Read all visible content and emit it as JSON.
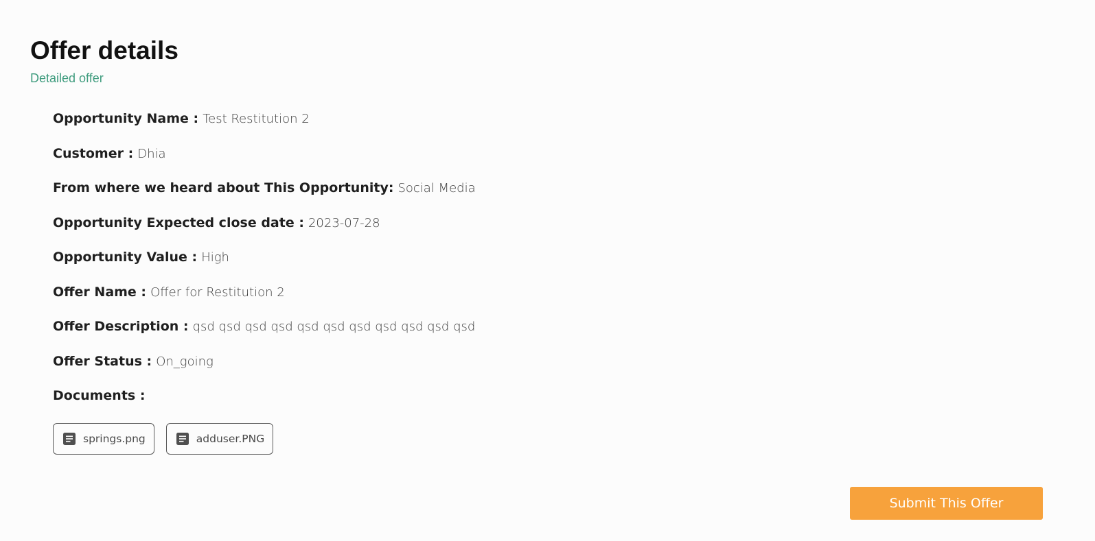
{
  "header": {
    "title": "Offer details",
    "subtitle": "Detailed offer"
  },
  "details": [
    {
      "label": "Opportunity Name :",
      "value": "Test Restitution 2"
    },
    {
      "label": "Customer :",
      "value": "Dhia"
    },
    {
      "label": "From where we heard about This Opportunity:",
      "value": "Social Media"
    },
    {
      "label": "Opportunity Expected close date :",
      "value": "2023-07-28"
    },
    {
      "label": "Opportunity Value :",
      "value": "High"
    },
    {
      "label": "Offer Name :",
      "value": "Offer for Restitution 2"
    },
    {
      "label": "Offer Description :",
      "value": "qsd qsd qsd qsd qsd qsd qsd qsd qsd qsd qsd"
    },
    {
      "label": "Offer Status :",
      "value": "On_going"
    },
    {
      "label": "Documents :",
      "value": ""
    }
  ],
  "documents": [
    {
      "name": "springs.png",
      "icon": "document-icon"
    },
    {
      "name": "adduser.PNG",
      "icon": "document-icon"
    }
  ],
  "actions": {
    "submit_label": "Submit This Offer"
  },
  "colors": {
    "subtitle": "#3f9c7e",
    "submit_button": "#f7a23c",
    "background": "#fcfcfc"
  }
}
